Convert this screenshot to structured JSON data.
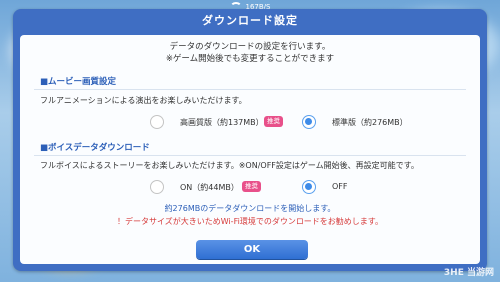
{
  "status_bar": {
    "speed": "167B/S"
  },
  "dialog": {
    "title": "ダウンロード設定",
    "intro_line1": "データのダウンロードの設定を行います。",
    "intro_line2": "※ゲーム開始後でも変更することができます",
    "movie": {
      "heading": "■ムービー画質設定",
      "description": "フルアニメーションによる演出をお楽しみいただけます。",
      "option_high": "高画質版（約137MB）",
      "badge": "推奨",
      "option_standard": "標準版（約276MB）",
      "selected": "standard"
    },
    "voice": {
      "heading": "■ボイスデータダウンロード",
      "description": "フルボイスによるストーリーをお楽しみいただけます。※ON/OFF設定はゲーム開始後、再設定可能です。",
      "option_on": "ON（約44MB）",
      "badge": "推奨",
      "option_off": "OFF",
      "selected": "off"
    },
    "summary": "約276MBのデータダウンロードを開始します。",
    "warning": "！データサイズが大きいためWi-Fi環境でのダウンロードをお勧めします。",
    "ok_label": "OK"
  },
  "watermark": "3HE 当游网",
  "colors": {
    "frame": "#3f6ec3",
    "accent": "#2c5fb8",
    "badge": "#e8508a",
    "warning": "#d63a3a",
    "radio_on": "#3e8be8"
  }
}
